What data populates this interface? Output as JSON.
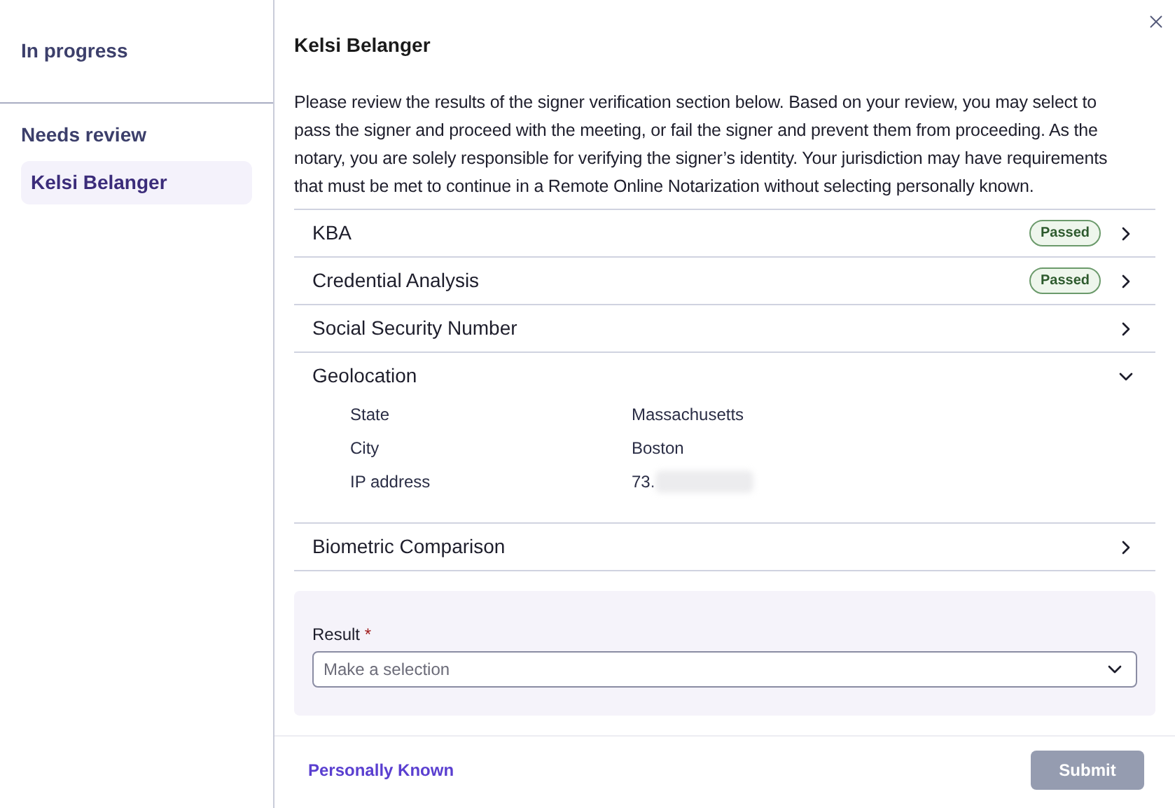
{
  "sidebar": {
    "groups": [
      {
        "title": "In progress"
      },
      {
        "title": "Needs review",
        "items": [
          {
            "label": "Kelsi Belanger",
            "selected": true
          }
        ]
      }
    ]
  },
  "panel": {
    "title": "Kelsi Belanger",
    "intro": "Please review the results of the signer verification section below. Based on your review, you may select to pass the signer and proceed with the meeting, or fail the signer and prevent them from proceeding. As the notary, you are solely responsible for verifying the signer’s identity. Your jurisdiction may have requirements that must be met to continue in a Remote Online Notarization without selecting personally known.",
    "sections": [
      {
        "label": "KBA",
        "badge": "Passed",
        "expanded": false
      },
      {
        "label": "Credential Analysis",
        "badge": "Passed",
        "expanded": false
      },
      {
        "label": "Social Security Number",
        "expanded": false
      },
      {
        "label": "Geolocation",
        "expanded": true,
        "details": [
          {
            "label": "State",
            "value": "Massachusetts"
          },
          {
            "label": "City",
            "value": "Boston"
          },
          {
            "label": "IP address",
            "value": "73.",
            "redacted": true
          }
        ]
      },
      {
        "label": "Biometric Comparison",
        "expanded": false
      }
    ],
    "result": {
      "label": "Result",
      "required_mark": "*",
      "placeholder": "Make a selection"
    },
    "footer": {
      "link": "Personally Known",
      "submit": {
        "label": "Submit",
        "disabled": true
      }
    }
  }
}
